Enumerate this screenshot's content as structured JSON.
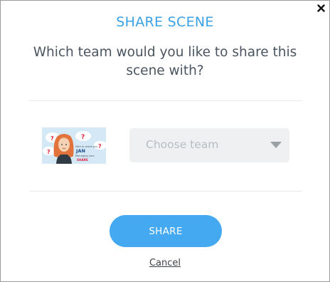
{
  "dialog": {
    "title": "SHARE SCENE",
    "question": "Which team would you like to share this scene with?",
    "close_icon": "close-icon"
  },
  "thumbnail": {
    "caption_top": "Nice to meet you",
    "caption_name": "JAN",
    "caption_line3": "Managing your",
    "caption_line4": "SHARE",
    "colors": {
      "hair": "#e2733c",
      "sky": "#cfe6f5",
      "question_mark": "#e0223a"
    }
  },
  "team_select": {
    "placeholder": "Choose team",
    "caret_icon": "caret-down-icon"
  },
  "actions": {
    "share_label": "SHARE",
    "cancel_label": "Cancel"
  },
  "colors": {
    "accent": "#3aa1e5",
    "button": "#45a9f2",
    "select_bg": "#eef0f2"
  }
}
